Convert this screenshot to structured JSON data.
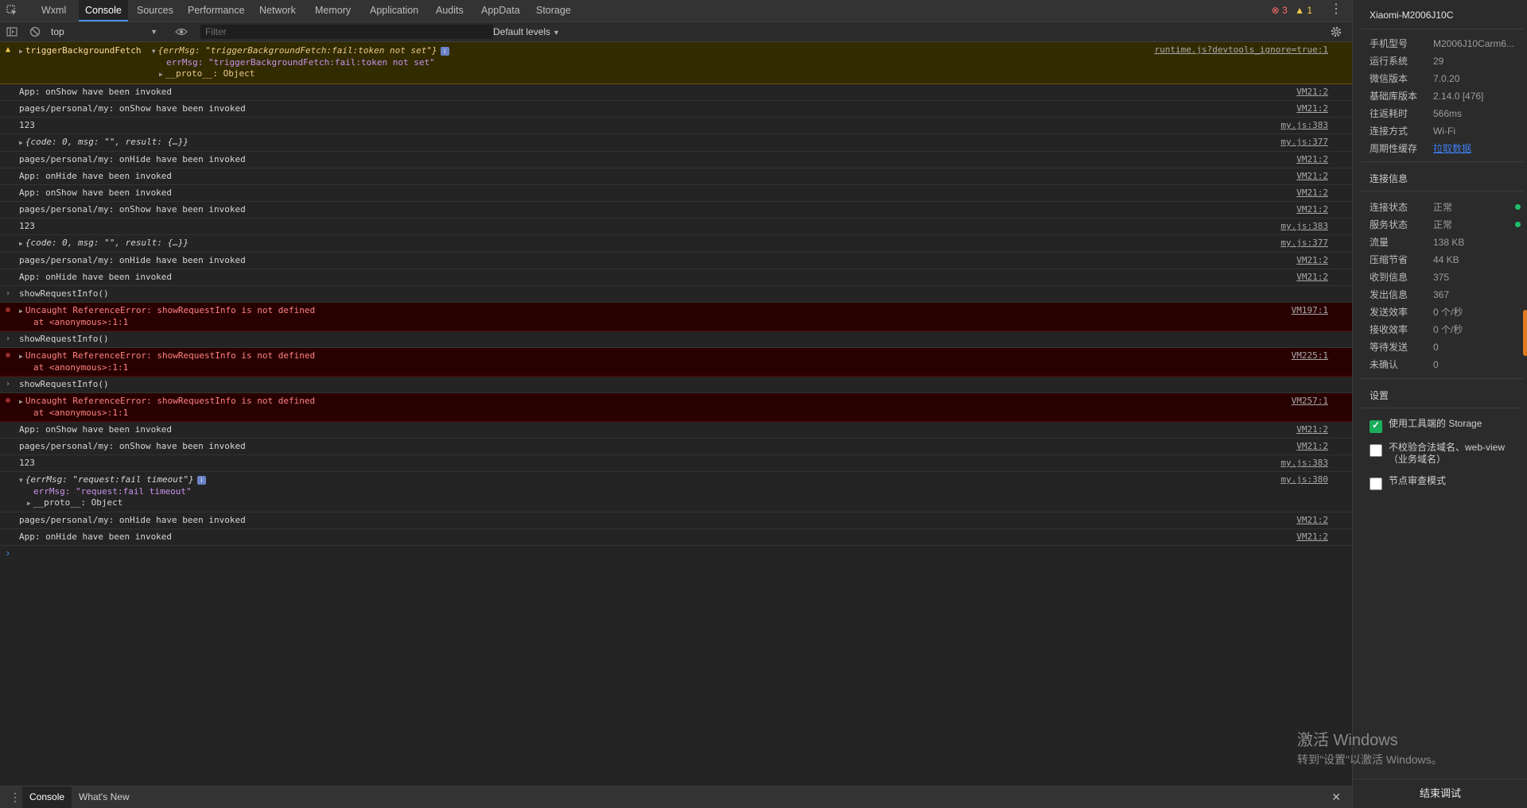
{
  "tabs": [
    "Wxml",
    "Console",
    "Sources",
    "Performance",
    "Network",
    "Memory",
    "Application",
    "Audits",
    "AppData",
    "Storage"
  ],
  "active_tab": "Console",
  "counts": {
    "errors": "3",
    "warnings": "1"
  },
  "toolbar": {
    "context": "top",
    "filter_placeholder": "Filter",
    "levels": "Default levels"
  },
  "console": [
    {
      "type": "warn",
      "lines": [
        {
          "text": "triggerBackgroundFetch"
        },
        {
          "text": "{errMsg: \"triggerBackgroundFetch:fail:token not set\"}"
        },
        {
          "text": "errMsg: \"triggerBackgroundFetch:fail:token not set\""
        },
        {
          "text": "__proto__: Object"
        }
      ],
      "src": "runtime.js?devtools_ignore=true:1"
    },
    {
      "type": "log",
      "text": "App: onShow have been invoked",
      "src": "VM21:2"
    },
    {
      "type": "log",
      "text": "pages/personal/my: onShow have been invoked",
      "src": "VM21:2"
    },
    {
      "type": "log",
      "text": "123",
      "src": "my.js:383"
    },
    {
      "type": "obj",
      "text": "{code: 0, msg: \"\", result: {…}}",
      "src": "my.js:377"
    },
    {
      "type": "log",
      "text": "pages/personal/my: onHide have been invoked",
      "src": "VM21:2"
    },
    {
      "type": "log",
      "text": "App: onHide have been invoked",
      "src": "VM21:2"
    },
    {
      "type": "log",
      "text": "App: onShow have been invoked",
      "src": "VM21:2"
    },
    {
      "type": "log",
      "text": "pages/personal/my: onShow have been invoked",
      "src": "VM21:2"
    },
    {
      "type": "log",
      "text": "123",
      "src": "my.js:383"
    },
    {
      "type": "obj",
      "text": "{code: 0, msg: \"\", result: {…}}",
      "src": "my.js:377"
    },
    {
      "type": "log",
      "text": "pages/personal/my: onHide have been invoked",
      "src": "VM21:2"
    },
    {
      "type": "log",
      "text": "App: onHide have been invoked",
      "src": "VM21:2"
    },
    {
      "type": "input",
      "text": "showRequestInfo()"
    },
    {
      "type": "error",
      "text": "Uncaught ReferenceError: showRequestInfo is not defined",
      "text2": "at <anonymous>:1:1",
      "src": "VM197:1"
    },
    {
      "type": "input",
      "text": "showRequestInfo()"
    },
    {
      "type": "error",
      "text": "Uncaught ReferenceError: showRequestInfo is not defined",
      "text2": "at <anonymous>:1:1",
      "src": "VM225:1"
    },
    {
      "type": "input",
      "text": "showRequestInfo()"
    },
    {
      "type": "error",
      "text": "Uncaught ReferenceError: showRequestInfo is not defined",
      "text2": "at <anonymous>:1:1",
      "src": "VM257:1"
    },
    {
      "type": "log",
      "text": "App: onShow have been invoked",
      "src": "VM21:2"
    },
    {
      "type": "log",
      "text": "pages/personal/my: onShow have been invoked",
      "src": "VM21:2"
    },
    {
      "type": "log",
      "text": "123",
      "src": "my.js:383"
    },
    {
      "type": "objx",
      "text": "{errMsg: \"request:fail timeout\"}",
      "text2": "errMsg: \"request:fail timeout\"",
      "text3": "__proto__: Object",
      "src": "my.js:380"
    },
    {
      "type": "log",
      "text": "pages/personal/my: onHide have been invoked",
      "src": "VM21:2"
    },
    {
      "type": "log",
      "text": "App: onHide have been invoked",
      "src": "VM21:2"
    }
  ],
  "drawer": {
    "tabs": [
      "Console",
      "What's New"
    ]
  },
  "panel": {
    "device": "Xiaomi-M2006J10C",
    "info": [
      {
        "k": "手机型号",
        "v": "M2006J10Carm6..."
      },
      {
        "k": "运行系统",
        "v": "29"
      },
      {
        "k": "微信版本",
        "v": "7.0.20"
      },
      {
        "k": "基础库版本",
        "v": "2.14.0 [476]"
      },
      {
        "k": "往返耗时",
        "v": "566ms"
      },
      {
        "k": "连接方式",
        "v": "Wi-Fi"
      },
      {
        "k": "周期性缓存",
        "v": "拉取数据"
      }
    ],
    "conn_title": "连接信息",
    "conn": [
      {
        "k": "连接状态",
        "v": "正常",
        "status": "ok"
      },
      {
        "k": "服务状态",
        "v": "正常",
        "status": "ok"
      },
      {
        "k": "流量",
        "v": "138 KB"
      },
      {
        "k": "压缩节省",
        "v": "44 KB"
      },
      {
        "k": "收到信息",
        "v": "375"
      },
      {
        "k": "发出信息",
        "v": "367"
      },
      {
        "k": "发送效率",
        "v": "0 个/秒"
      },
      {
        "k": "接收效率",
        "v": "0 个/秒"
      },
      {
        "k": "等待发送",
        "v": "0"
      },
      {
        "k": "未确认",
        "v": "0"
      }
    ],
    "settings_title": "设置",
    "settings": [
      {
        "label": "使用工具端的 Storage",
        "checked": true
      },
      {
        "label": "不校验合法域名、web-view（业务域名）",
        "checked": false
      },
      {
        "label": "节点审查模式",
        "checked": false
      }
    ],
    "end_button": "结束调试"
  },
  "watermark": {
    "line1": "激活 Windows",
    "line2": "转到\"设置\"以激活 Windows。"
  },
  "colors": {
    "accent": "#4d8ef7",
    "error_bg": "#290000",
    "warn_bg": "#332b00",
    "ok": "#1fbf6b"
  }
}
